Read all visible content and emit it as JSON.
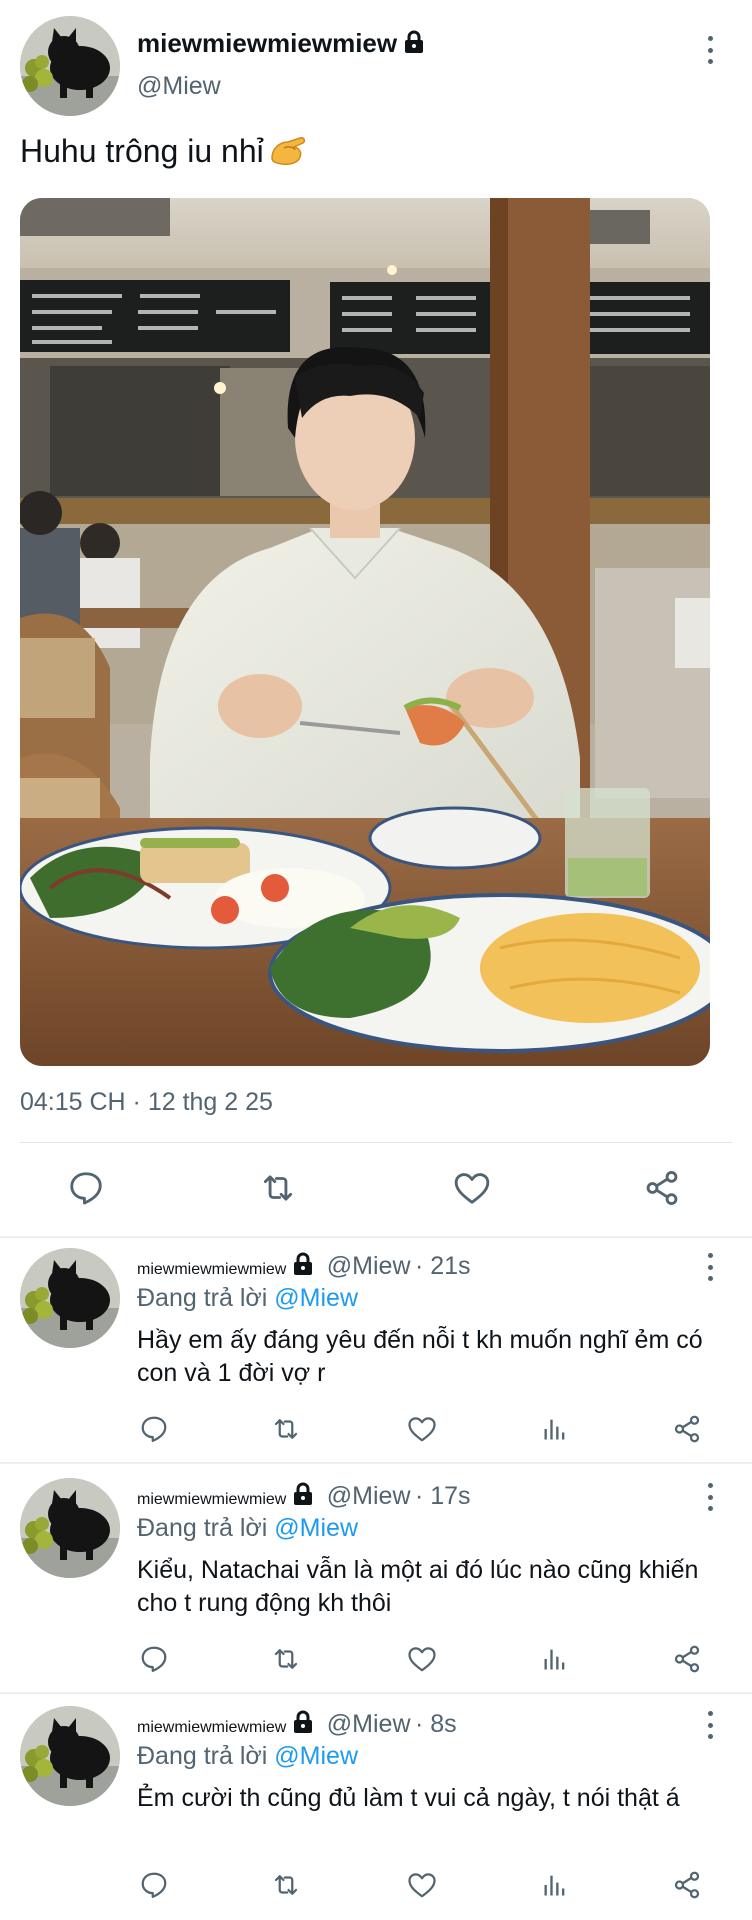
{
  "main_tweet": {
    "display_name": "miewmiewmiewmiew",
    "handle": "@Miew",
    "text": "Huhu trông iu nhỉ",
    "timestamp": "04:15 CH · 12 thg 2 25"
  },
  "icons": {
    "lock": "lock-icon",
    "more": "more-vertical-icon",
    "reply": "reply-icon",
    "retweet": "retweet-icon",
    "like": "heart-icon",
    "views": "analytics-icon",
    "share": "share-icon",
    "emoji": "pinching-hand-emoji"
  },
  "colors": {
    "accent": "#1d9bf0",
    "secondary_text": "#536471"
  },
  "replies": [
    {
      "display_name": "miewmiewmiewmiew",
      "handle": "@Miew",
      "time": "· 21s",
      "replying_prefix": "Đang trả lời",
      "replying_to": "@Miew",
      "text": "Hầy em ấy đáng yêu đến nỗi t kh muốn nghĩ ẻm có con và 1 đời vợ r"
    },
    {
      "display_name": "miewmiewmiewmiew",
      "handle": "@Miew",
      "time": "· 17s",
      "replying_prefix": "Đang trả lời",
      "replying_to": "@Miew",
      "text": "Kiểu, Natachai vẫn là một ai đó lúc nào cũng khiến cho t rung động kh thôi"
    },
    {
      "display_name": "miewmiewmiewmiew",
      "handle": "@Miew",
      "time": "· 8s",
      "replying_prefix": "Đang trả lời",
      "replying_to": "@Miew",
      "text": "Ẻm cười th cũng đủ làm t vui cả ngày, t nói thật á"
    }
  ]
}
